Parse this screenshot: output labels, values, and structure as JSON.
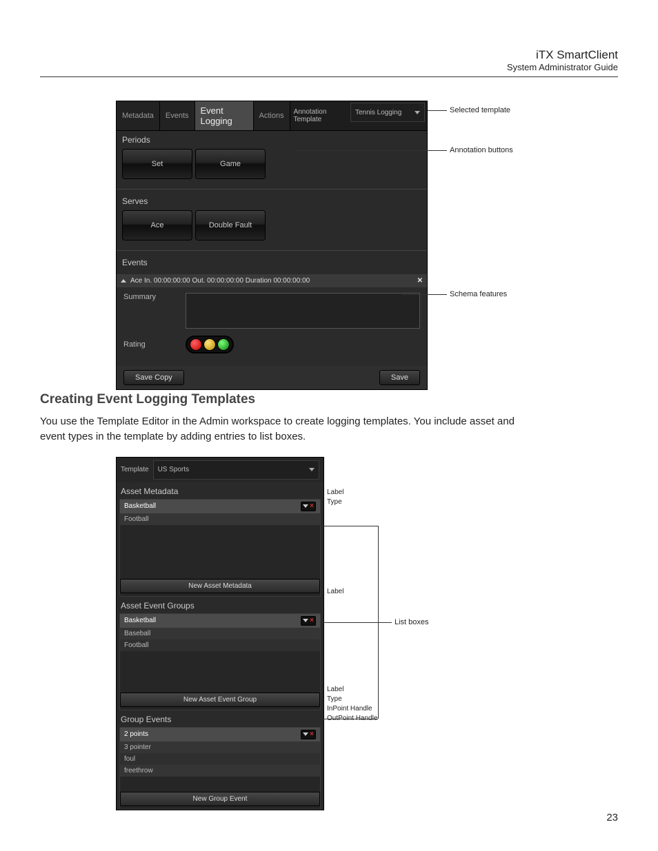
{
  "doc": {
    "title": "iTX SmartClient",
    "subtitle": "System Administrator Guide",
    "page_number": "23"
  },
  "fig1": {
    "tabs": [
      "Metadata",
      "Events",
      "Event Logging",
      "Actions"
    ],
    "active_tab": "Event Logging",
    "template_label": "Annotation Template",
    "template_value": "Tennis Logging",
    "sections": {
      "periods": {
        "title": "Periods",
        "buttons": [
          "Set",
          "Game"
        ]
      },
      "serves": {
        "title": "Serves",
        "buttons": [
          "Ace",
          "Double Fault"
        ]
      }
    },
    "events_title": "Events",
    "event_row": "Ace   In. 00:00:00:00  Out. 00:00:00:00  Duration 00:00:00:00",
    "summary_label": "Summary",
    "rating_label": "Rating",
    "save_copy": "Save Copy",
    "save": "Save",
    "callouts": {
      "selected_template": "Selected template",
      "annotation_buttons": "Annotation buttons",
      "schema_features": "Schema features"
    }
  },
  "section_heading": "Creating Event Logging Templates",
  "body_para": "You use the Template Editor in the Admin workspace to create logging templates. You include asset and event types in the template by adding entries to list boxes.",
  "fig2": {
    "template_label": "Template",
    "template_value": "US Sports",
    "asset_metadata": {
      "title": "Asset Metadata",
      "items": [
        "Basketball",
        "Football"
      ],
      "selected": "Basketball",
      "button": "New Asset Metadata",
      "side": [
        "Label",
        "Type"
      ]
    },
    "asset_event_groups": {
      "title": "Asset Event Groups",
      "items": [
        "Basketball",
        "Baseball",
        "Football"
      ],
      "selected": "Basketball",
      "button": "New Asset Event Group",
      "side": [
        "Label"
      ]
    },
    "group_events": {
      "title": "Group Events",
      "items": [
        "2 points",
        "3 pointer",
        "foul",
        "freethrow"
      ],
      "selected": "2 points",
      "button": "New Group Event",
      "side": [
        "Label",
        "Type",
        "InPoint Handle",
        "OutPoint Handle"
      ]
    },
    "callout": "List boxes"
  }
}
